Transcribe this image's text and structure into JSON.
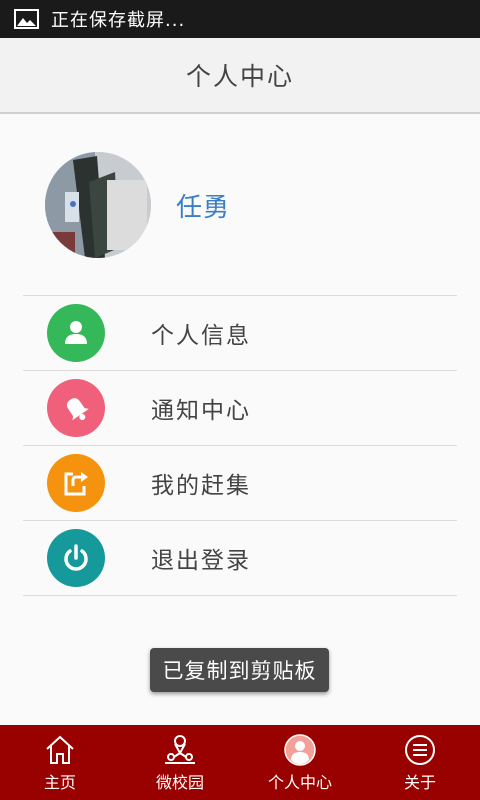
{
  "status_bar": {
    "notification_text": "正在保存截屏...",
    "icon": "image-icon"
  },
  "header": {
    "title": "个人中心"
  },
  "profile": {
    "username": "任勇",
    "avatar": "avatar-photo"
  },
  "menu": {
    "items": [
      {
        "label": "个人信息",
        "icon": "person-icon",
        "color": "#35b85a"
      },
      {
        "label": "通知中心",
        "icon": "bell-icon",
        "color": "#f0607a"
      },
      {
        "label": "我的赶集",
        "icon": "share-icon",
        "color": "#f5930f"
      },
      {
        "label": "退出登录",
        "icon": "power-icon",
        "color": "#16999a"
      }
    ]
  },
  "toast": {
    "text": "已复制到剪贴板"
  },
  "tab_bar": {
    "background": "#990000",
    "tabs": [
      {
        "label": "主页",
        "icon": "home-icon"
      },
      {
        "label": "微校园",
        "icon": "campus-icon"
      },
      {
        "label": "个人中心",
        "icon": "profile-icon",
        "active": true
      },
      {
        "label": "关于",
        "icon": "about-icon"
      }
    ]
  }
}
